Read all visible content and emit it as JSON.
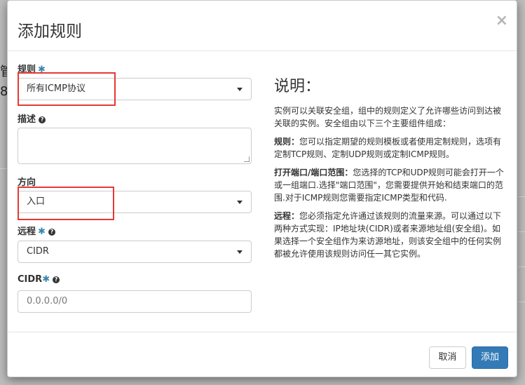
{
  "modal": {
    "title": "添加规则",
    "close_glyph": "×"
  },
  "form": {
    "rule": {
      "label": "规则",
      "required_mark": "✱",
      "selected": "所有ICMP协议"
    },
    "description": {
      "label": "描述",
      "help_glyph": "?",
      "value": ""
    },
    "direction": {
      "label": "方向",
      "selected": "入口"
    },
    "remote": {
      "label": "远程",
      "required_mark": "✱",
      "help_glyph": "?",
      "selected": "CIDR"
    },
    "cidr": {
      "label": "CIDR",
      "required_mark": "✱",
      "help_glyph": "?",
      "placeholder": "0.0.0.0/0"
    }
  },
  "help_panel": {
    "title": "说明：",
    "intro": "实例可以关联安全组，组中的规则定义了允许哪些访问到达被关联的实例。安全组由以下三个主要组件组成：",
    "rule_term": "规则：",
    "rule_text": "您可以指定期望的规则模板或者使用定制规则，选项有定制TCP规则、定制UDP规则或定制ICMP规则。",
    "port_term": "打开端口/端口范围：",
    "port_text": "您选择的TCP和UDP规则可能会打开一个或一组端口.选择\"端口范围\"，您需要提供开始和结束端口的范围.对于ICMP规则您需要指定ICMP类型和代码.",
    "remote_term": "远程：",
    "remote_text": "您必须指定允许通过该规则的流量来源。可以通过以下两种方式实现：IP地址块(CIDR)或者来源地址组(安全组)。如果选择一个安全组作为来访源地址，则该安全组中的任何实例都被允许使用该规则访问任一其它实例。"
  },
  "footer": {
    "cancel_label": "取消",
    "add_label": "添加"
  },
  "colors": {
    "primary": "#337ab7",
    "highlight": "#e53935",
    "required": "#3a87ad"
  }
}
